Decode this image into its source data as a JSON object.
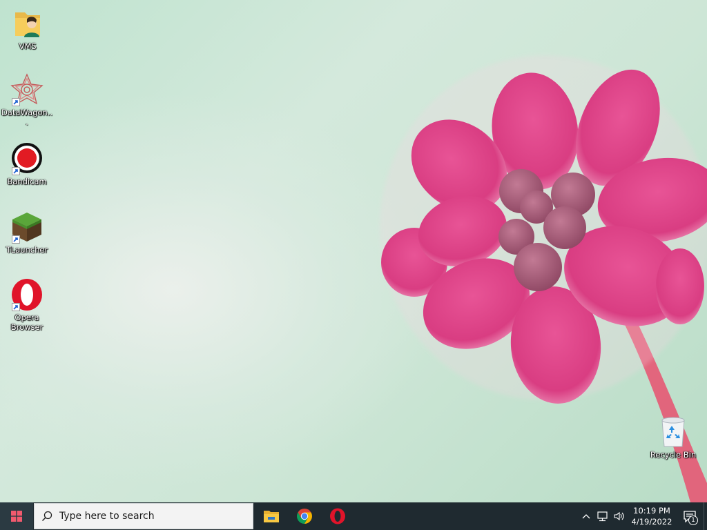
{
  "desktop": {
    "icons": [
      {
        "label": "VMS",
        "icon": "folder-user-icon"
      },
      {
        "label": "DataWagon...",
        "icon": "datawagon-icon"
      },
      {
        "label": "Bandicam",
        "icon": "bandicam-icon"
      },
      {
        "label": "TLauncher",
        "icon": "tlauncher-grass-block-icon"
      },
      {
        "label": "Opera Browser",
        "icon": "opera-icon"
      },
      {
        "label": "Recycle Bin",
        "icon": "recycle-bin-icon"
      }
    ],
    "wallpaper": "pink-flower-on-mint-green"
  },
  "taskbar": {
    "start_icon": "windows-logo-icon",
    "search_placeholder": "Type here to search",
    "pinned_apps": [
      {
        "name": "File Explorer",
        "icon": "file-explorer-icon"
      },
      {
        "name": "Google Chrome",
        "icon": "chrome-icon"
      },
      {
        "name": "Opera",
        "icon": "opera-icon"
      }
    ],
    "tray": {
      "time": "10:19 PM",
      "date": "4/19/2022",
      "notification_count": "1",
      "icons": [
        "chevron-up-icon",
        "network-icon",
        "volume-icon"
      ]
    }
  },
  "colors": {
    "taskbar_bg": "#1f2a30",
    "start_bg": "#2b3a42",
    "search_bg": "#f3f3f3",
    "flower_pink": "#e0468a",
    "wallpaper_green": "#bfe3cf"
  }
}
